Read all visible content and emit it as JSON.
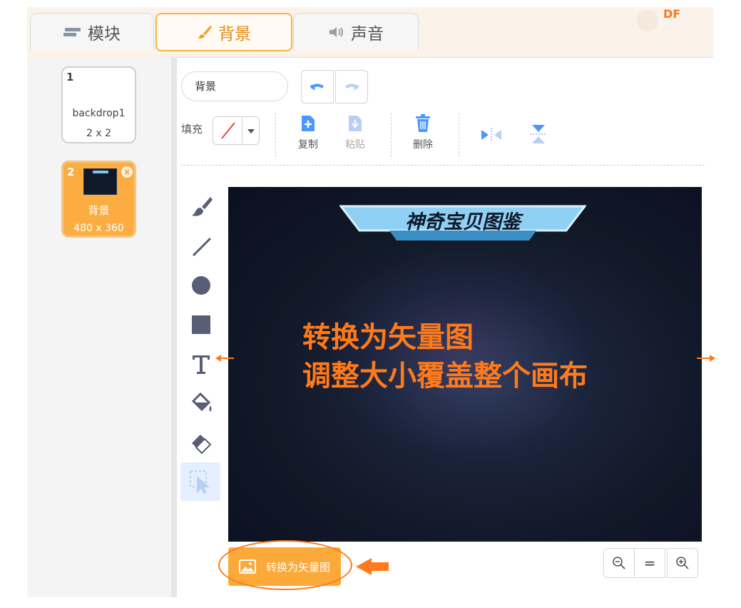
{
  "tabs": [
    {
      "label": "模块",
      "icon": "blocks-icon"
    },
    {
      "label": "背景",
      "icon": "brush-icon"
    },
    {
      "label": "声音",
      "icon": "speaker-icon"
    }
  ],
  "watermark": "DF",
  "backdrops": [
    {
      "number": "1",
      "name": "backdrop1",
      "size": "2 x 2"
    },
    {
      "number": "2",
      "name": "背景",
      "size": "480 x 360"
    }
  ],
  "editor": {
    "name_value": "背景",
    "fill_label": "填充",
    "copy_label": "复制",
    "paste_label": "粘贴",
    "delete_label": "删除"
  },
  "canvas": {
    "banner_text": "神奇宝贝图鉴",
    "caption_line1": "转换为矢量图",
    "caption_line2": "调整大小覆盖整个画布"
  },
  "convert_button": "转换为矢量图",
  "zoom": {
    "reset": "="
  },
  "colors": {
    "accent": "#fbaa3a",
    "annotation": "#ff7a1a",
    "active_tab": "#e68a14",
    "canvas_bg": "#111827"
  }
}
